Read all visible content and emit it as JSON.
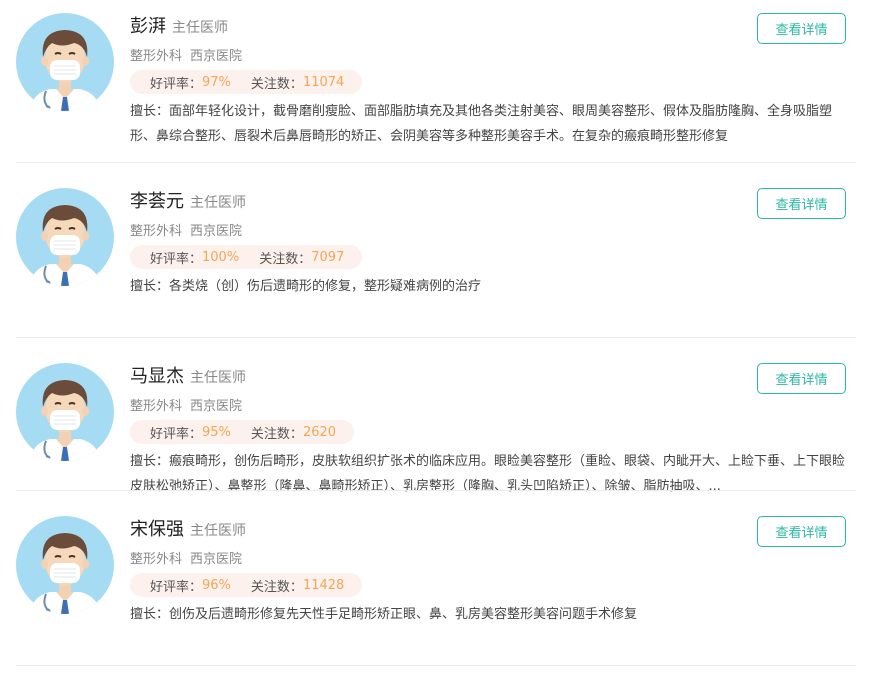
{
  "doctors": [
    {
      "name": "彭湃",
      "title": "主任医师",
      "department": "整形外科",
      "hospital": "西京医院",
      "rating_label": "好评率：",
      "rating_value": "97%",
      "followers_label": "关注数：",
      "followers_value": "11074",
      "skills": "擅长：面部年轻化设计，截骨磨削瘦脸、面部脂肪填充及其他各类注射美容、眼周美容整形、假体及脂肪隆胸、全身吸脂塑形、鼻综合整形、唇裂术后鼻唇畸形的矫正、会阴美容等多种整形美容手术。在复杂的瘢痕畸形整形修复",
      "button_label": "查看详情",
      "avatar_icon": "doctor-avatar-icon"
    },
    {
      "name": "李荟元",
      "title": "主任医师",
      "department": "整形外科",
      "hospital": "西京医院",
      "rating_label": "好评率：",
      "rating_value": "100%",
      "followers_label": "关注数：",
      "followers_value": "7097",
      "skills": "擅长：各类烧（创）伤后遗畸形的修复，整形疑难病例的治疗",
      "button_label": "查看详情",
      "avatar_icon": "doctor-avatar-icon"
    },
    {
      "name": "马显杰",
      "title": "主任医师",
      "department": "整形外科",
      "hospital": "西京医院",
      "rating_label": "好评率：",
      "rating_value": "95%",
      "followers_label": "关注数：",
      "followers_value": "2620",
      "skills": "擅长：瘢痕畸形，创伤后畸形，皮肤软组织扩张术的临床应用。眼睑美容整形（重睑、眼袋、内眦开大、上睑下垂、上下眼睑皮肤松弛矫正）、鼻整形（隆鼻、鼻畸形矫正）、乳房整形（隆胸、乳头凹陷矫正）、除皱、脂肪抽吸、...",
      "button_label": "查看详情",
      "avatar_icon": "doctor-avatar-icon"
    },
    {
      "name": "宋保强",
      "title": "主任医师",
      "department": "整形外科",
      "hospital": "西京医院",
      "rating_label": "好评率：",
      "rating_value": "96%",
      "followers_label": "关注数：",
      "followers_value": "11428",
      "skills": "擅长：创伤及后遗畸形修复先天性手足畸形矫正眼、鼻、乳房美容整形美容问题手术修复",
      "button_label": "查看详情",
      "avatar_icon": "doctor-avatar-icon"
    }
  ],
  "colors": {
    "accent": "#2bb8a4",
    "stat_value": "#f5a552",
    "stat_bg": "#fdf1ee",
    "avatar_bg": "#a6dbf4"
  }
}
